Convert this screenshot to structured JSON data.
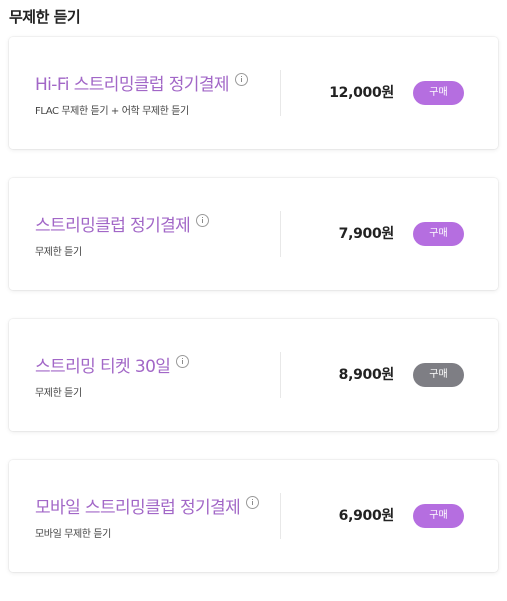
{
  "section": {
    "title": "무제한 듣기"
  },
  "plans": [
    {
      "name": "Hi-Fi 스트리밍클럽 정기결제",
      "description": "FLAC 무제한 듣기 + 어학 무제한 듣기",
      "price": "12,000원",
      "button_label": "구매",
      "button_color": "#b56ee0"
    },
    {
      "name": "스트리밍클럽 정기결제",
      "description": "무제한 듣기",
      "price": "7,900원",
      "button_label": "구매",
      "button_color": "#b56ee0"
    },
    {
      "name": "스트리밍 티켓 30일",
      "description": "무제한 듣기",
      "price": "8,900원",
      "button_label": "구매",
      "button_color": "#7e7e84"
    },
    {
      "name": "모바일 스트리밍클럽 정기결제",
      "description": "모바일 무제한 듣기",
      "price": "6,900원",
      "button_label": "구매",
      "button_color": "#b56ee0"
    }
  ],
  "colors": {
    "plan_name": "#a267c7",
    "accent_button": "#b56ee0",
    "muted_button": "#7e7e84"
  },
  "icons": {
    "info": "info-circle-icon"
  }
}
